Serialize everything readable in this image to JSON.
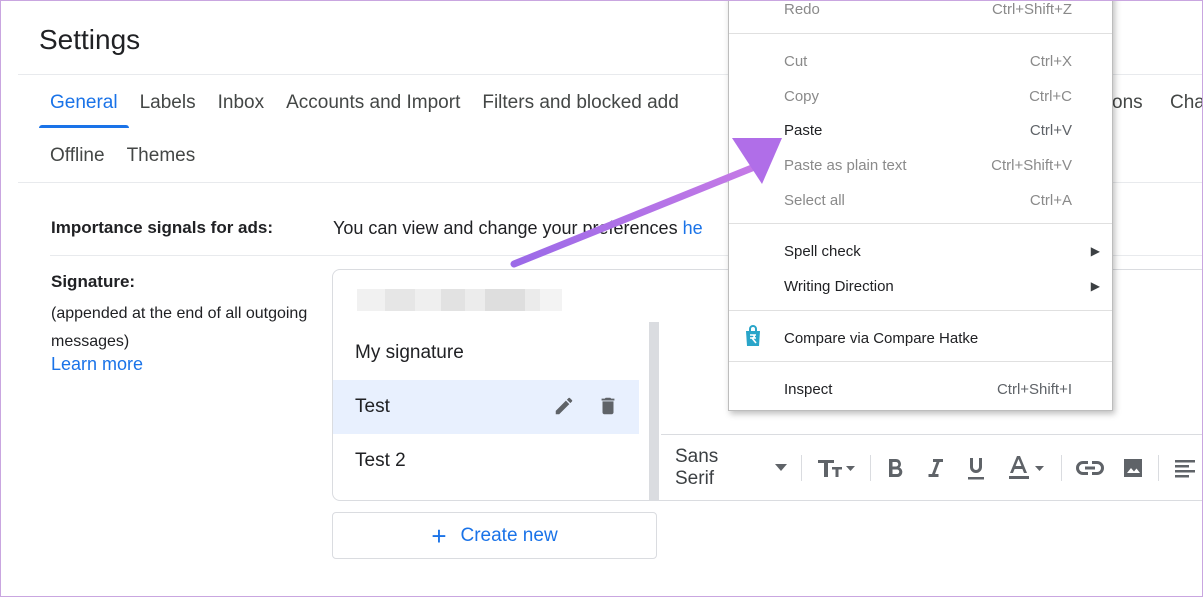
{
  "page_title": "Settings",
  "tabs_row1": [
    "General",
    "Labels",
    "Inbox",
    "Accounts and Import",
    "Filters and blocked add"
  ],
  "tabs_row1_right": [
    "ons",
    "Cha"
  ],
  "tabs_row2": [
    "Offline",
    "Themes"
  ],
  "importance": {
    "label": "Importance signals for ads:",
    "text": "You can view and change your preferences ",
    "link": "he"
  },
  "signature": {
    "label": "Signature:",
    "sub": "(appended at the end of all outgoing messages)",
    "learn_more": "Learn more",
    "items": [
      "My signature",
      "Test",
      "Test 2"
    ],
    "create_new": "Create new"
  },
  "toolbar": {
    "font": "Sans Serif"
  },
  "context_menu": {
    "items": [
      {
        "label": "Redo",
        "shortcut": "Ctrl+Shift+Z",
        "disabled": true
      },
      {
        "label": "Cut",
        "shortcut": "Ctrl+X",
        "disabled": true
      },
      {
        "label": "Copy",
        "shortcut": "Ctrl+C",
        "disabled": true
      },
      {
        "label": "Paste",
        "shortcut": "Ctrl+V",
        "disabled": false
      },
      {
        "label": "Paste as plain text",
        "shortcut": "Ctrl+Shift+V",
        "disabled": true
      },
      {
        "label": "Select all",
        "shortcut": "Ctrl+A",
        "disabled": true
      },
      {
        "label": "Spell check",
        "shortcut": "",
        "disabled": false
      },
      {
        "label": "Writing Direction",
        "shortcut": "",
        "disabled": false
      },
      {
        "label": "Compare via Compare Hatke",
        "shortcut": "",
        "disabled": false
      },
      {
        "label": "Inspect",
        "shortcut": "Ctrl+Shift+I",
        "disabled": false
      }
    ]
  },
  "colors": {
    "accent": "#1a73e8",
    "selected_bg": "#e8f0fe",
    "arrow": "#a560e8"
  }
}
